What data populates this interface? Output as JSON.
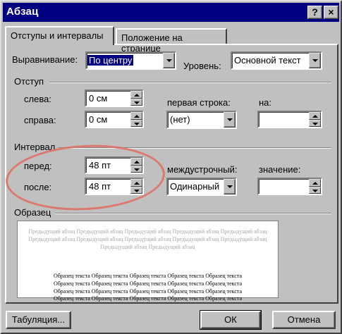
{
  "window": {
    "title": "Абзац",
    "help_label": "?",
    "close_label": "×"
  },
  "tabs": [
    {
      "label": "Отступы и интервалы",
      "active": true
    },
    {
      "label": "Положение на странице",
      "active": false
    }
  ],
  "alignment": {
    "label": "Выравнивание:",
    "value": "По центру"
  },
  "level": {
    "label": "Уровень:",
    "value": "Основной текст"
  },
  "indent": {
    "group_label": "Отступ",
    "left_label": "слева:",
    "left_value": "0 см",
    "right_label": "справа:",
    "right_value": "0 см",
    "first_line_label": "первая строка:",
    "first_line_value": "(нет)",
    "by_label": "на:",
    "by_value": ""
  },
  "spacing": {
    "group_label": "Интервал",
    "before_label": "перед:",
    "before_value": "48 пт",
    "after_label": "после:",
    "after_value": "48 пт",
    "line_label": "междустрочный:",
    "line_value": "Одинарный",
    "at_label": "значение:",
    "at_value": ""
  },
  "sample": {
    "group_label": "Образец",
    "previous_lines": [
      "Предыдущий абзац Предыдущий абзац Предыдущий абзац Предыдущий абзац Предыдущий абзац",
      "Предыдущий абзац Предыдущий абзац Предыдущий абзац Предыдущий абзац Предыдущий абзац",
      "Предыдущий абзац Предыдущий абзац"
    ],
    "sample_lines": [
      "Образец текста Образец текста Образец текста Образец текста Образец текста",
      "Образец текста Образец текста Образец текста Образец текста Образец текста",
      "Образец текста Образец текста Образец текста Образец текста Образец текста",
      "Образец текста Образец текста Образец текста Образец текста Образец текста"
    ]
  },
  "buttons": {
    "tabs_label": "Табуляция...",
    "ok_label": "ОК",
    "cancel_label": "Отмена"
  },
  "colors": {
    "titlebar": "#000080",
    "selection": "#000080",
    "annotation_circle": "#e06b5e"
  }
}
